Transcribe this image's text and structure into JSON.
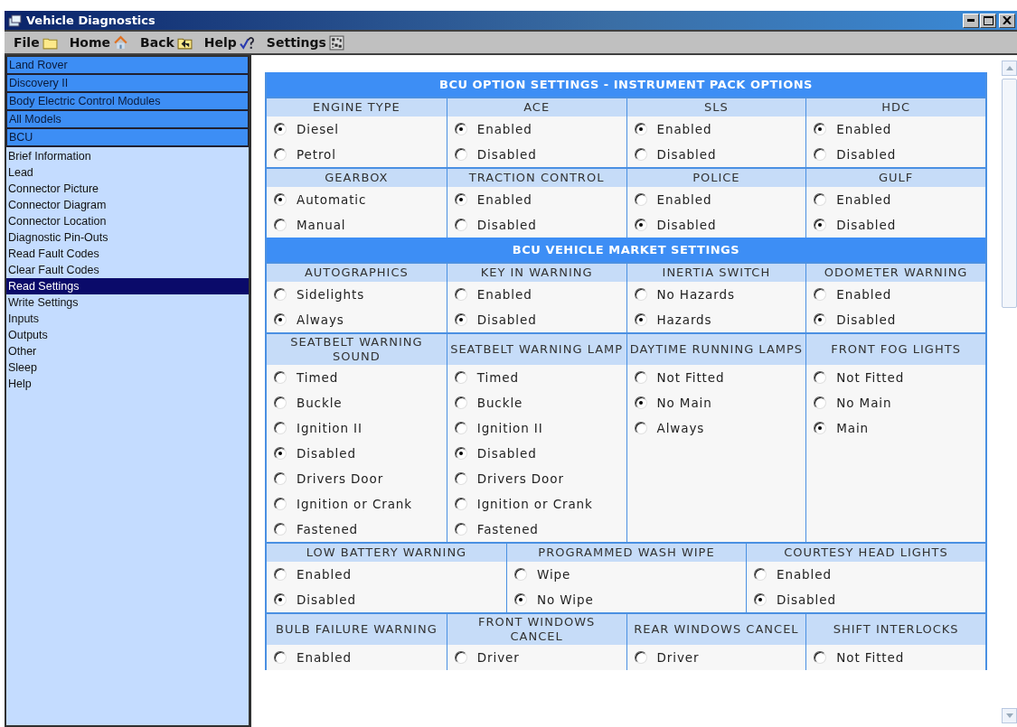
{
  "window": {
    "title": "Vehicle Diagnostics"
  },
  "menu": [
    {
      "label": "File",
      "kind": "folder"
    },
    {
      "label": "Home",
      "kind": "home"
    },
    {
      "label": "Back",
      "kind": "back"
    },
    {
      "label": "Help",
      "kind": "help"
    },
    {
      "label": "Settings",
      "kind": "settings"
    }
  ],
  "sidebar": {
    "breadcrumbs": [
      "Land Rover",
      "Discovery II",
      "Body Electric Control Modules",
      "All Models",
      "BCU"
    ],
    "items": [
      {
        "label": "Brief Information",
        "selected": false
      },
      {
        "label": "Lead",
        "selected": false
      },
      {
        "label": "Connector Picture",
        "selected": false
      },
      {
        "label": "Connector Diagram",
        "selected": false
      },
      {
        "label": "Connector Location",
        "selected": false
      },
      {
        "label": "Diagnostic Pin-Outs",
        "selected": false
      },
      {
        "label": "Read Fault Codes",
        "selected": false
      },
      {
        "label": "Clear Fault Codes",
        "selected": false
      },
      {
        "label": "Read Settings",
        "selected": true
      },
      {
        "label": "Write Settings",
        "selected": false
      },
      {
        "label": "Inputs",
        "selected": false
      },
      {
        "label": "Outputs",
        "selected": false
      },
      {
        "label": "Other",
        "selected": false
      },
      {
        "label": "Sleep",
        "selected": false
      },
      {
        "label": "Help",
        "selected": false
      }
    ]
  },
  "sections": [
    {
      "title": "BCU OPTION SETTINGS - INSTRUMENT PACK OPTIONS",
      "rows": [
        {
          "groups": [
            {
              "heading": "ENGINE TYPE",
              "options": [
                {
                  "label": "Diesel",
                  "selected": true
                },
                {
                  "label": "Petrol",
                  "selected": false
                }
              ]
            },
            {
              "heading": "ACE",
              "options": [
                {
                  "label": "Enabled",
                  "selected": true
                },
                {
                  "label": "Disabled",
                  "selected": false
                }
              ]
            },
            {
              "heading": "SLS",
              "options": [
                {
                  "label": "Enabled",
                  "selected": true
                },
                {
                  "label": "Disabled",
                  "selected": false
                }
              ]
            },
            {
              "heading": "HDC",
              "options": [
                {
                  "label": "Enabled",
                  "selected": true
                },
                {
                  "label": "Disabled",
                  "selected": false
                }
              ]
            }
          ]
        },
        {
          "groups": [
            {
              "heading": "GEARBOX",
              "options": [
                {
                  "label": "Automatic",
                  "selected": true
                },
                {
                  "label": "Manual",
                  "selected": false
                }
              ]
            },
            {
              "heading": "TRACTION CONTROL",
              "options": [
                {
                  "label": "Enabled",
                  "selected": true
                },
                {
                  "label": "Disabled",
                  "selected": false
                }
              ]
            },
            {
              "heading": "POLICE",
              "options": [
                {
                  "label": "Enabled",
                  "selected": false
                },
                {
                  "label": "Disabled",
                  "selected": true
                }
              ]
            },
            {
              "heading": "GULF",
              "options": [
                {
                  "label": "Enabled",
                  "selected": false
                },
                {
                  "label": "Disabled",
                  "selected": true
                }
              ]
            }
          ]
        }
      ]
    },
    {
      "title": "BCU VEHICLE MARKET SETTINGS",
      "rows": [
        {
          "groups": [
            {
              "heading": "AUTOGRAPHICS",
              "options": [
                {
                  "label": "Sidelights",
                  "selected": false
                },
                {
                  "label": "Always",
                  "selected": true
                }
              ]
            },
            {
              "heading": "KEY IN WARNING",
              "options": [
                {
                  "label": "Enabled",
                  "selected": false
                },
                {
                  "label": "Disabled",
                  "selected": true
                }
              ]
            },
            {
              "heading": "INERTIA SWITCH",
              "options": [
                {
                  "label": "No Hazards",
                  "selected": false
                },
                {
                  "label": "Hazards",
                  "selected": true
                }
              ]
            },
            {
              "heading": "ODOMETER WARNING",
              "options": [
                {
                  "label": "Enabled",
                  "selected": false
                },
                {
                  "label": "Disabled",
                  "selected": true
                }
              ]
            }
          ]
        },
        {
          "groups": [
            {
              "heading": "SEATBELT WARNING SOUND",
              "options": [
                {
                  "label": "Timed",
                  "selected": false
                },
                {
                  "label": "Buckle",
                  "selected": false
                },
                {
                  "label": "Ignition II",
                  "selected": false
                },
                {
                  "label": "Disabled",
                  "selected": true
                },
                {
                  "label": "Drivers Door",
                  "selected": false
                },
                {
                  "label": "Ignition or Crank",
                  "selected": false
                },
                {
                  "label": "Fastened",
                  "selected": false
                }
              ]
            },
            {
              "heading": "SEATBELT WARNING LAMP",
              "options": [
                {
                  "label": "Timed",
                  "selected": false
                },
                {
                  "label": "Buckle",
                  "selected": false
                },
                {
                  "label": "Ignition II",
                  "selected": false
                },
                {
                  "label": "Disabled",
                  "selected": true
                },
                {
                  "label": "Drivers Door",
                  "selected": false
                },
                {
                  "label": "Ignition or Crank",
                  "selected": false
                },
                {
                  "label": "Fastened",
                  "selected": false
                }
              ]
            },
            {
              "heading": "DAYTIME RUNNING LAMPS",
              "options": [
                {
                  "label": "Not Fitted",
                  "selected": false
                },
                {
                  "label": "No Main",
                  "selected": true
                },
                {
                  "label": "Always",
                  "selected": false
                }
              ]
            },
            {
              "heading": "FRONT FOG LIGHTS",
              "options": [
                {
                  "label": "Not Fitted",
                  "selected": false
                },
                {
                  "label": "No Main",
                  "selected": false
                },
                {
                  "label": "Main",
                  "selected": true
                }
              ]
            }
          ]
        },
        {
          "groups": [
            {
              "heading": "LOW BATTERY WARNING",
              "options": [
                {
                  "label": "Enabled",
                  "selected": false
                },
                {
                  "label": "Disabled",
                  "selected": true
                }
              ]
            },
            {
              "heading": "PROGRAMMED WASH WIPE",
              "options": [
                {
                  "label": "Wipe",
                  "selected": false
                },
                {
                  "label": "No Wipe",
                  "selected": true
                }
              ]
            },
            {
              "heading": "COURTESY HEAD LIGHTS",
              "options": [
                {
                  "label": "Enabled",
                  "selected": false
                },
                {
                  "label": "Disabled",
                  "selected": true
                }
              ]
            }
          ]
        },
        {
          "groups": [
            {
              "heading": "BULB FAILURE WARNING",
              "options": [
                {
                  "label": "Enabled",
                  "selected": false
                }
              ]
            },
            {
              "heading": "FRONT WINDOWS CANCEL",
              "options": [
                {
                  "label": "Driver",
                  "selected": false
                }
              ]
            },
            {
              "heading": "REAR WINDOWS CANCEL",
              "options": [
                {
                  "label": "Driver",
                  "selected": false
                }
              ]
            },
            {
              "heading": "SHIFT INTERLOCKS",
              "options": [
                {
                  "label": "Not Fitted",
                  "selected": false
                }
              ]
            }
          ]
        }
      ]
    }
  ]
}
